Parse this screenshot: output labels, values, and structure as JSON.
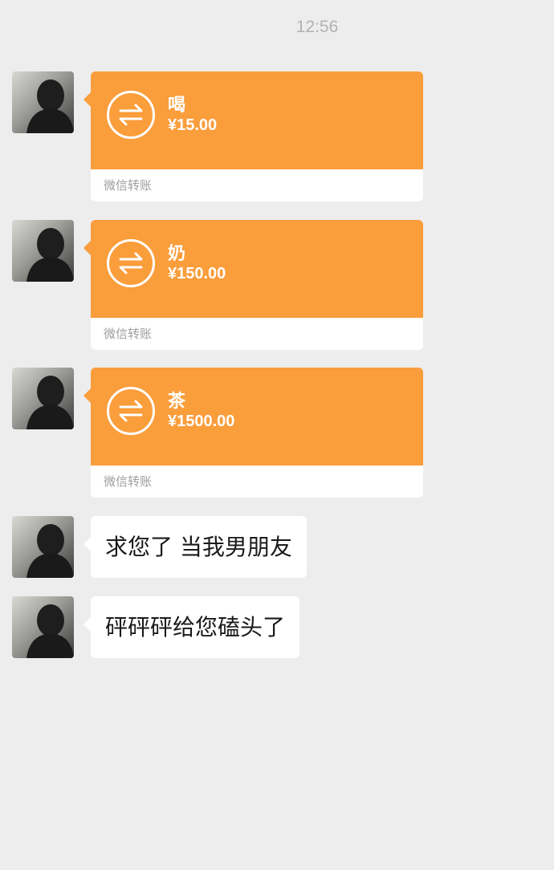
{
  "timestamp": "12:56",
  "messages": [
    {
      "type": "transfer",
      "note": "喝",
      "amount": "¥15.00",
      "footer": "微信转账"
    },
    {
      "type": "transfer",
      "note": "奶",
      "amount": "¥150.00",
      "footer": "微信转账"
    },
    {
      "type": "transfer",
      "note": "茶",
      "amount": "¥1500.00",
      "footer": "微信转账"
    },
    {
      "type": "text",
      "text": "求您了 当我男朋友"
    },
    {
      "type": "text",
      "text": "砰砰砰给您磕头了"
    }
  ],
  "colors": {
    "background": "#ededed",
    "transfer_orange": "#fa9d3b",
    "bubble_white": "#ffffff",
    "timestamp_gray": "#b2b2b2"
  },
  "icons": {
    "avatar": "avatar-image",
    "transfer": "transfer-arrows-icon"
  }
}
